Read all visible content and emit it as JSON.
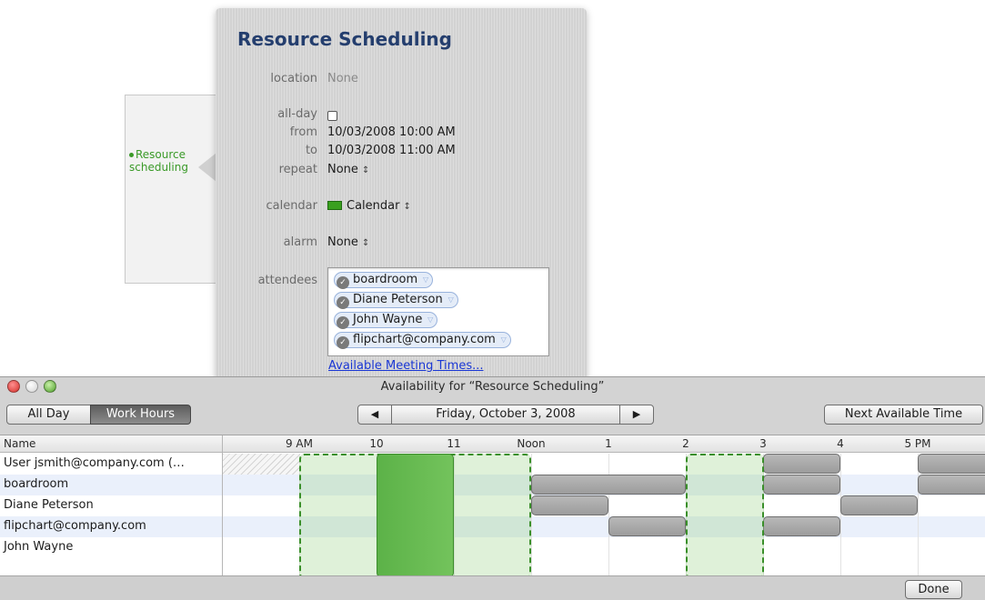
{
  "event_snippet": {
    "title": "Resource\nscheduling",
    "color": "#3a9a28"
  },
  "inspector": {
    "title": "Resource Scheduling",
    "fields": {
      "location_label": "location",
      "location_value": "None",
      "allday_label": "all-day",
      "allday_checked": false,
      "from_label": "from",
      "from_value": "10/03/2008 10:00 AM",
      "to_label": "to",
      "to_value": "10/03/2008 11:00 AM",
      "repeat_label": "repeat",
      "repeat_value": "None",
      "calendar_label": "calendar",
      "calendar_value": "Calendar",
      "calendar_color": "#3aa01f",
      "alarm_label": "alarm",
      "alarm_value": "None",
      "attendees_label": "attendees"
    },
    "attendees": [
      "boardroom",
      "Diane Peterson",
      "John Wayne",
      "flipchart@company.com"
    ],
    "available_link": "Available Meeting Times..."
  },
  "availability": {
    "window_title": "Availability for “Resource Scheduling”",
    "mode_all_day": "All Day",
    "mode_work_hours": "Work Hours",
    "selected_mode": "Work Hours",
    "date": "Friday, October 3, 2008",
    "prev_icon": "◀",
    "next_icon": "▶",
    "next_available": "Next Available Time",
    "name_header": "Name",
    "hours": [
      "9 AM",
      "10",
      "11",
      "Noon",
      "1",
      "2",
      "3",
      "4",
      "5 PM"
    ],
    "rows": [
      {
        "name": "User jsmith@company.com (…"
      },
      {
        "name": "boardroom"
      },
      {
        "name": "Diane Peterson"
      },
      {
        "name": "flipchart@company.com"
      },
      {
        "name": "John Wayne"
      }
    ],
    "done": "Done"
  }
}
